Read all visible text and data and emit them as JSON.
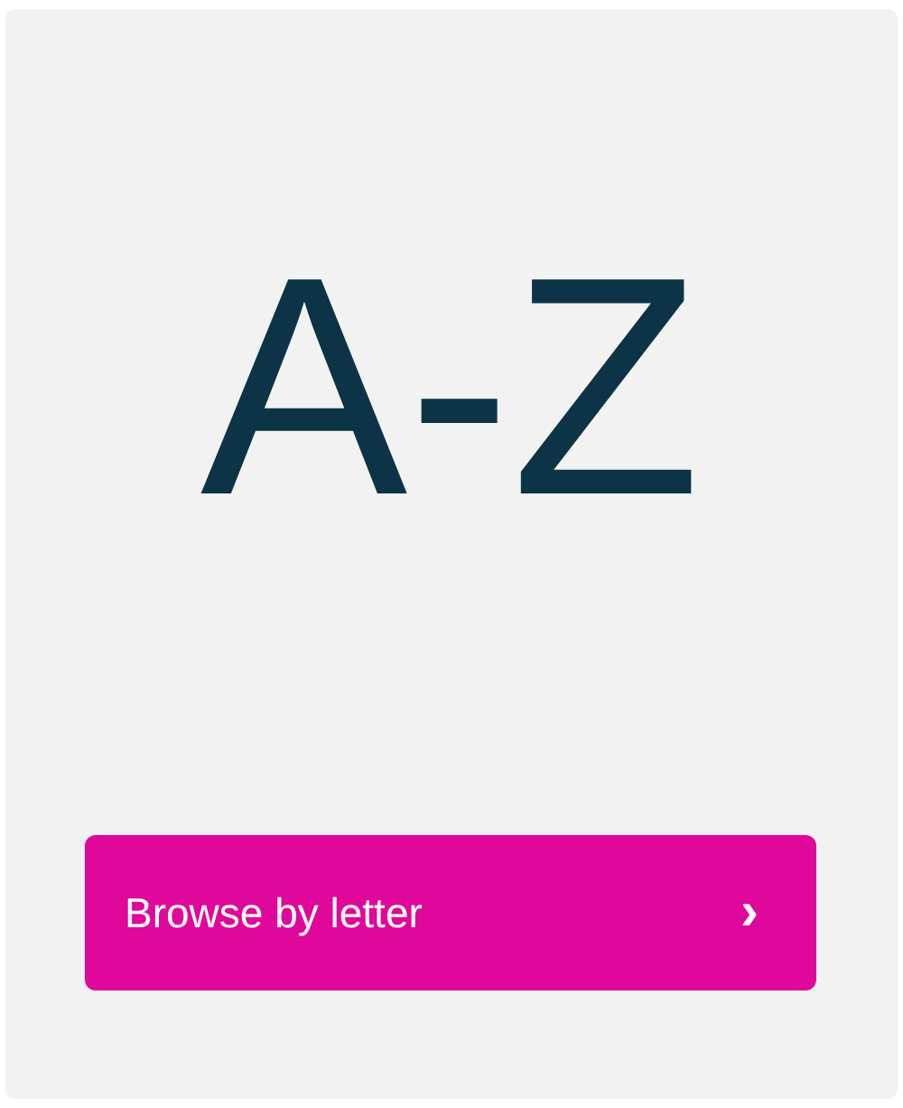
{
  "heading": "A-Z",
  "button": {
    "label": "Browse by letter",
    "chevron": "›"
  }
}
